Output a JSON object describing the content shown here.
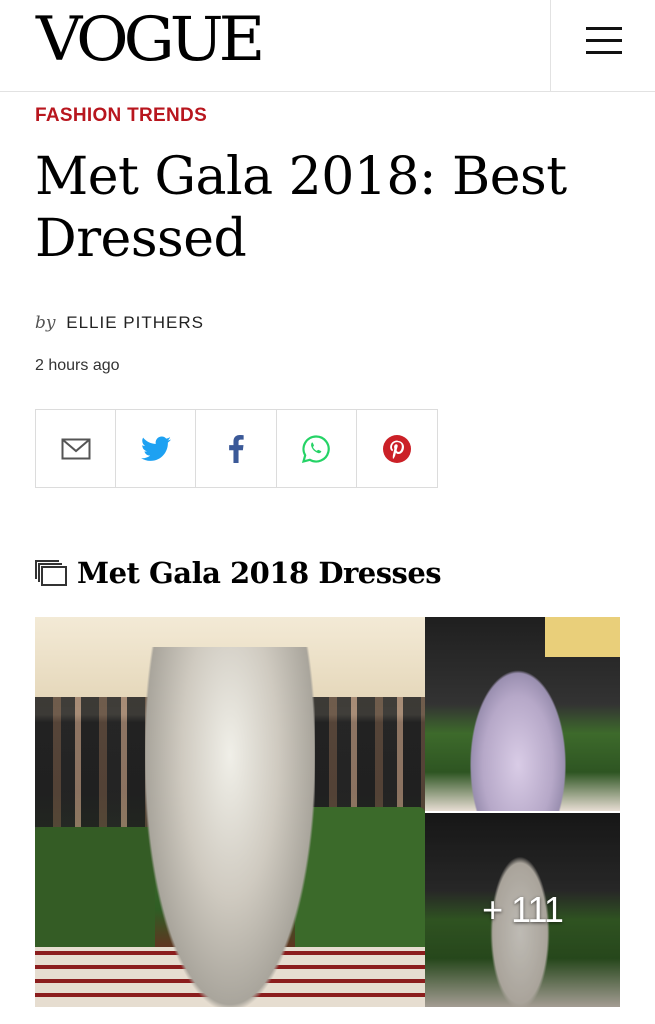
{
  "header": {
    "logo": "VOGUE",
    "menu_icon": "hamburger-menu-icon"
  },
  "article": {
    "category": "FASHION TRENDS",
    "title": "Met Gala 2018: Best Dressed",
    "by_prefix": "by",
    "author": "ELLIE PITHERS",
    "timestamp": "2 hours ago"
  },
  "share": {
    "buttons": [
      {
        "icon": "email-icon",
        "color": "#555555"
      },
      {
        "icon": "twitter-icon",
        "color": "#1da1f2"
      },
      {
        "icon": "facebook-icon",
        "color": "#3b5998"
      },
      {
        "icon": "whatsapp-icon",
        "color": "#25d366"
      },
      {
        "icon": "pinterest-icon",
        "color": "#cb2027"
      }
    ]
  },
  "gallery": {
    "icon": "gallery-icon",
    "title": "Met Gala 2018 Dresses",
    "more_count": "+ 111"
  },
  "colors": {
    "accent": "#b8161e",
    "border": "#dcdcdc"
  }
}
